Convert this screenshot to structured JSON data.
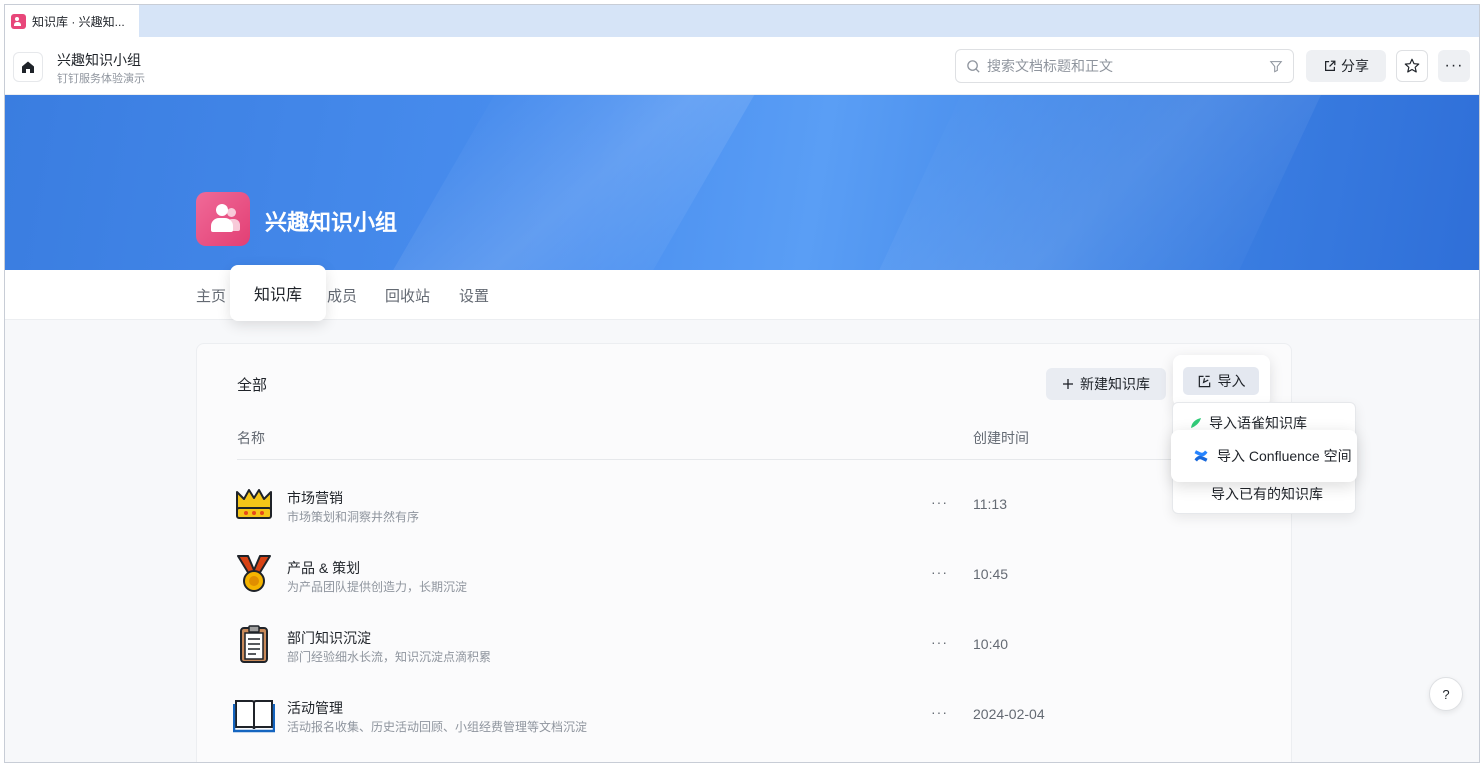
{
  "browser": {
    "tab_title": "知识库 · 兴趣知..."
  },
  "header": {
    "workspace_name": "兴趣知识小组",
    "workspace_subtitle": "钉钉服务体验演示",
    "search_placeholder": "搜索文档标题和正文",
    "share_label": "分享",
    "more_label": "···"
  },
  "banner": {
    "group_title": "兴趣知识小组"
  },
  "nav": {
    "items": [
      "主页",
      "知识库",
      "成员",
      "回收站",
      "设置"
    ],
    "active": "知识库"
  },
  "main": {
    "section_title": "全部",
    "new_button_label": "新建知识库",
    "import_button_label": "导入",
    "columns": {
      "name": "名称",
      "created": "创建时间"
    },
    "more_label": "···",
    "rows": [
      {
        "icon": "crown-icon",
        "name": "市场营销",
        "desc": "市场策划和洞察井然有序",
        "time": "11:13"
      },
      {
        "icon": "medal-icon",
        "name": "产品 & 策划",
        "desc": "为产品团队提供创造力，长期沉淀",
        "time": "10:45"
      },
      {
        "icon": "clipboard-icon",
        "name": "部门知识沉淀",
        "desc": "部门经验细水长流，知识沉淀点滴积累",
        "time": "10:40"
      },
      {
        "icon": "book-icon",
        "name": "活动管理",
        "desc": "活动报名收集、历史活动回顾、小组经费管理等文档沉淀",
        "time": "2024-02-04"
      }
    ]
  },
  "import_menu": {
    "items": [
      "导入语雀知识库",
      "导入 Confluence 空间",
      "导入已有的知识库"
    ]
  },
  "help": {
    "label": "?"
  },
  "colors": {
    "accent": "#3a7de0",
    "avatar": "#e8477a"
  }
}
